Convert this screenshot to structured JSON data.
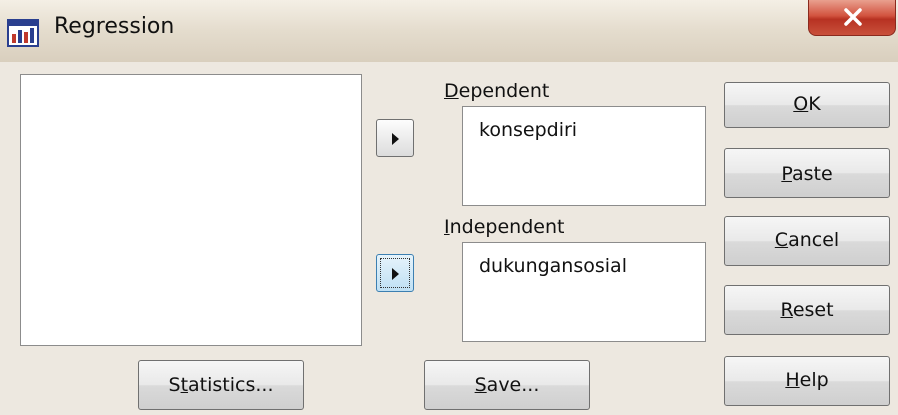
{
  "window": {
    "title": "Regression"
  },
  "variables_list": {
    "items": []
  },
  "dependent": {
    "label_mnemonic": "D",
    "label_rest": "ependent",
    "value": "konsepdiri"
  },
  "independent": {
    "label_mnemonic": "I",
    "label_rest": "ndependent",
    "value": "dukungansosial"
  },
  "buttons": {
    "ok": {
      "mnemonic": "O",
      "rest": "K"
    },
    "paste": {
      "mnemonic": "P",
      "rest": "aste"
    },
    "cancel": {
      "mnemonic": "C",
      "rest": "ancel"
    },
    "reset": {
      "mnemonic": "R",
      "rest": "eset"
    },
    "help": {
      "mnemonic": "H",
      "rest": "elp"
    },
    "statistics": {
      "pre": "S",
      "mnemonic": "t",
      "rest": "atistics..."
    },
    "save": {
      "mnemonic": "S",
      "rest": "ave..."
    }
  },
  "icons": {
    "app": "spss-app-icon",
    "close": "close-icon",
    "move_dependent": "right-arrow-icon",
    "move_independent": "right-arrow-icon"
  },
  "colors": {
    "dialog_bg": "#ede8e0",
    "close_button": "#c9503b",
    "focus_button": "#bfe0f4"
  }
}
